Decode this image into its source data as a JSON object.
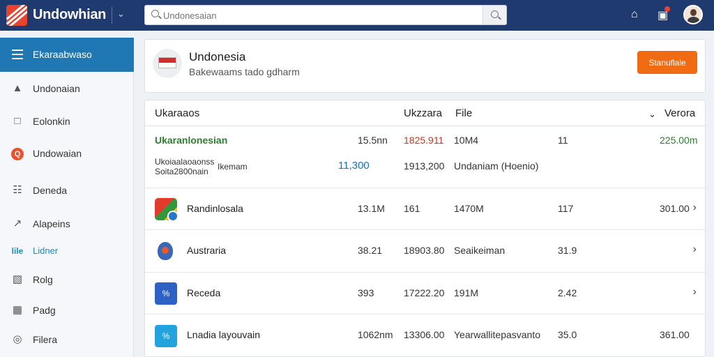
{
  "app": {
    "title": "Undowhian",
    "caret": "⌄"
  },
  "search": {
    "placeholder": "Undonesaian"
  },
  "topbar": {
    "home_icon": "⌂",
    "bag_icon": "▣"
  },
  "sidebar": {
    "header": "Ekaraabwaso",
    "items": [
      {
        "label": "Undonaian",
        "icon": "▲"
      },
      {
        "label": "Eolonkin",
        "icon": "□"
      },
      {
        "label": "Undowaian",
        "icon": "Q"
      },
      {
        "label": "Deneda",
        "icon": "☷"
      },
      {
        "label": "Alapeins",
        "icon": "↗"
      },
      {
        "label": "Lidner",
        "icon": "lile"
      },
      {
        "label": "Rolg",
        "icon": "▧"
      },
      {
        "label": "Padg",
        "icon": "▦"
      },
      {
        "label": "Filera",
        "icon": "◎"
      }
    ]
  },
  "header": {
    "title": "Undonesia",
    "subtitle": "Bakewaams tado gdharm",
    "button": "Stanuflale"
  },
  "table": {
    "headers": {
      "name": "Ukaraaos",
      "col2": "Ukzzara",
      "col3": "File",
      "col4": "Verora",
      "sort_icon": "⌄"
    },
    "rows": [
      {
        "name": "Ukaranlonesian",
        "c1": "15.5nn",
        "c2": "1825.911",
        "c3": "10M4",
        "c4": "11",
        "c5": "225.00m",
        "sub_name_1": "Ukoiaalaoaonss",
        "sub_name_2": "Soita2800nain",
        "sub_name_side": "Ikemam",
        "sub_c1": "11,300",
        "sub_c2": "1913,200",
        "sub_c3": "Undaniam (Hoenio)"
      },
      {
        "name": "Randinlosala",
        "c1": "13.1M",
        "c2": "161",
        "c3": "1470M",
        "c4": "117",
        "c5": "301.00",
        "chev": "›"
      },
      {
        "name": "Austraria",
        "c1": "38.21",
        "c2": "18903.80",
        "c3": "Seaikeiman",
        "c4": "31.9",
        "c5": "",
        "chev": "›"
      },
      {
        "name": "Receda",
        "c1": "393",
        "c2": "17222.20",
        "c3": "191M",
        "c4": "2.42",
        "c5": "",
        "chev": "›",
        "icon": "%"
      },
      {
        "name": "Lnadia layouvain",
        "c1": "1062nm",
        "c2": "13306.00",
        "c3": "Yearwallitepasvanto",
        "c4": "35.0",
        "c5": "361.00",
        "chev": "›",
        "icon": "%"
      }
    ]
  },
  "colors": {
    "topbar": "#1e3a6e",
    "sidebar_active": "#1f78b4",
    "accent_button": "#f06b12",
    "green_text": "#2f7d2d",
    "blue_text": "#1872b6"
  }
}
